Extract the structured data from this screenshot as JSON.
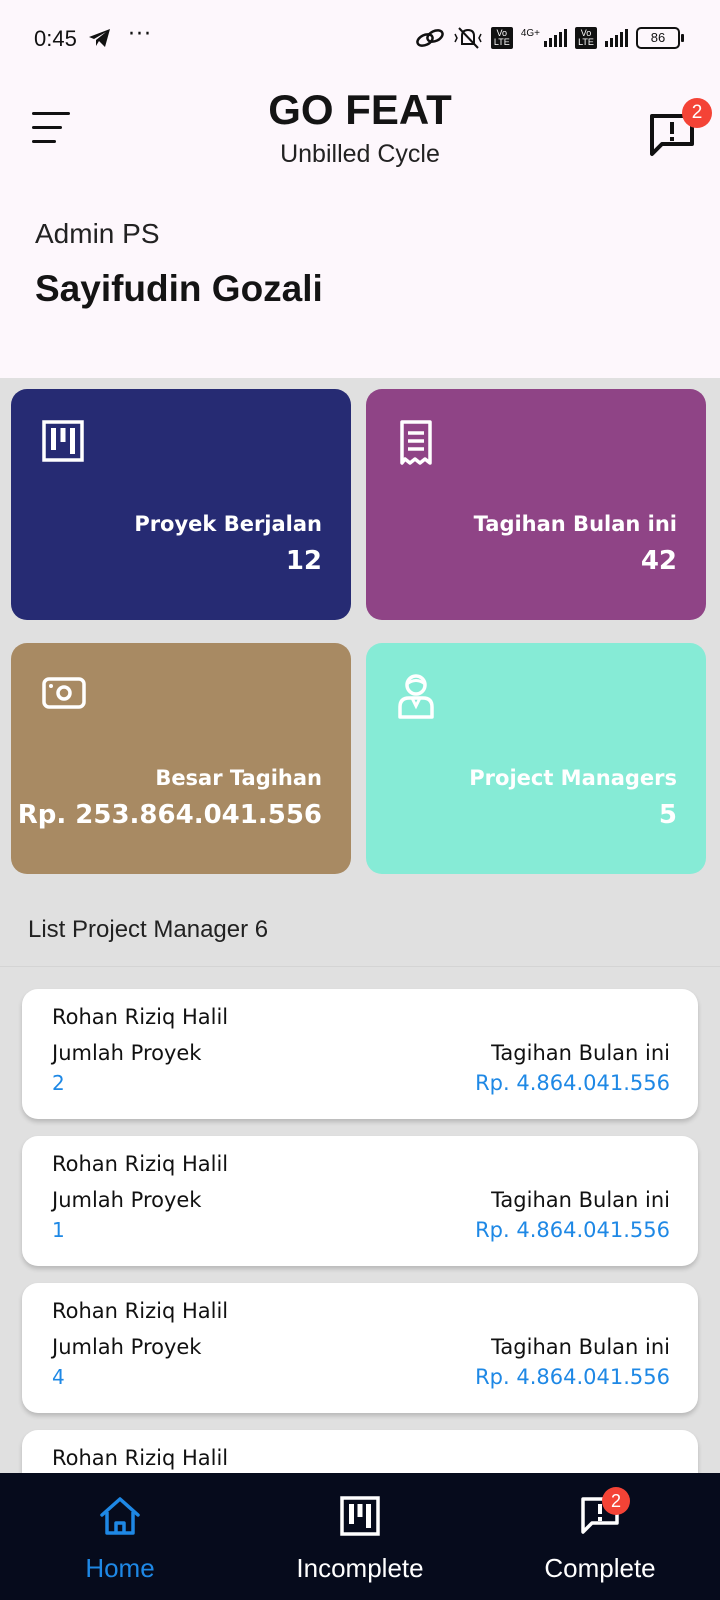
{
  "status_bar": {
    "time": "0:45",
    "dots": "···",
    "network_label": "4G+",
    "volte_label": "Vo LTE",
    "battery": "86",
    "icons": [
      "telegram-icon",
      "link-icon",
      "mute-icon",
      "signal-icon",
      "battery-icon"
    ]
  },
  "header": {
    "title": "GO FEAT",
    "subtitle": "Unbilled Cycle",
    "notification_count": "2",
    "role": "Admin PS",
    "user_name": "Sayifudin Gozali"
  },
  "stats": [
    {
      "label": "Proyek Berjalan",
      "value": "12",
      "color": "#262b73",
      "icon": "kanban-icon"
    },
    {
      "label": "Tagihan Bulan ini",
      "value": "42",
      "color": "#8f4486",
      "icon": "receipt-icon"
    },
    {
      "label": "Besar Tagihan",
      "value": "Rp. 253.864.041.556",
      "color": "#a88a63",
      "icon": "money-icon"
    },
    {
      "label": "Project Managers",
      "value": "5",
      "color": "#86ebd6",
      "icon": "manager-icon"
    }
  ],
  "list": {
    "title": "List Project Manager 6",
    "items": [
      {
        "name": "Rohan Riziq Halil",
        "count_label": "Jumlah Proyek",
        "count": "2",
        "bill_label": "Tagihan Bulan ini",
        "bill": "Rp. 4.864.041.556"
      },
      {
        "name": "Rohan Riziq Halil",
        "count_label": "Jumlah Proyek",
        "count": "1",
        "bill_label": "Tagihan Bulan ini",
        "bill": "Rp. 4.864.041.556"
      },
      {
        "name": "Rohan Riziq Halil",
        "count_label": "Jumlah Proyek",
        "count": "4",
        "bill_label": "Tagihan Bulan ini",
        "bill": "Rp. 4.864.041.556"
      },
      {
        "name": "Rohan Riziq Halil"
      }
    ]
  },
  "bottom_nav": {
    "items": [
      {
        "label": "Home",
        "icon": "home-icon",
        "active": true,
        "color": "#1e88e5"
      },
      {
        "label": "Incomplete",
        "icon": "kanban-icon",
        "active": false
      },
      {
        "label": "Complete",
        "icon": "chat-alert-icon",
        "active": false,
        "badge": "2"
      }
    ]
  }
}
